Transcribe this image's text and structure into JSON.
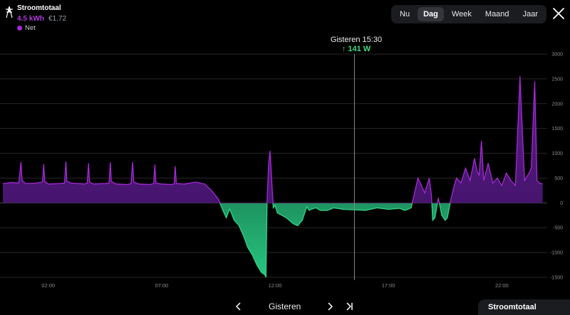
{
  "header": {
    "icon": "power-tower-icon",
    "title": "Stroomtotaal",
    "kwh_value": "4.5",
    "kwh_unit": "kWh",
    "cost": "€1.72",
    "legend_label": "Net"
  },
  "tabs": [
    {
      "label": "Nu",
      "active": false
    },
    {
      "label": "Dag",
      "active": true
    },
    {
      "label": "Week",
      "active": false
    },
    {
      "label": "Maand",
      "active": false
    },
    {
      "label": "Jaar",
      "active": false
    }
  ],
  "close_icon": "close-icon",
  "cursor": {
    "time_label": "Gisteren 15:30",
    "value_label": "↑ 141 W",
    "time_hours": 15.5
  },
  "colors": {
    "import": "#a629d8",
    "export": "#2fd487",
    "cursor_value": "#3ddc84"
  },
  "chart_data": {
    "type": "area",
    "ylabel": "",
    "y_ticks": [
      "3000",
      "2500",
      "2000",
      "1500",
      "1000",
      "500",
      "0",
      "-500",
      "-1000",
      "-1500"
    ],
    "ylim": [
      -1500,
      3000
    ],
    "x_ticks": [
      {
        "label": "02:00",
        "hour": 2
      },
      {
        "label": "07:00",
        "hour": 7
      },
      {
        "label": "12:00",
        "hour": 12
      },
      {
        "label": "17:00",
        "hour": 17
      },
      {
        "label": "22:00",
        "hour": 22
      }
    ],
    "xlim": [
      0,
      24
    ],
    "grid": true,
    "series": [
      {
        "x": [
          0.0,
          0.4,
          0.7,
          0.8,
          0.85,
          1.0,
          1.5,
          1.75,
          1.8,
          1.85,
          2.0,
          2.5,
          2.72,
          2.78,
          2.82,
          3.0,
          3.6,
          3.72,
          3.78,
          3.82,
          4.0,
          4.5,
          4.68,
          4.74,
          4.78,
          5.0,
          5.5,
          5.65,
          5.72,
          5.77,
          6.0,
          6.5,
          6.65,
          6.7,
          6.75,
          7.0,
          7.4,
          7.55,
          7.6,
          7.65,
          8.0,
          8.5,
          8.9,
          9.2,
          9.5,
          9.7,
          9.85,
          10.0,
          10.2,
          10.4,
          10.6,
          10.8,
          11.0,
          11.2,
          11.4,
          11.55,
          11.6,
          11.65,
          11.72,
          11.78,
          11.85,
          11.92,
          12.0,
          12.1,
          12.3,
          12.5,
          12.8,
          13.0,
          13.2,
          13.4,
          13.5,
          13.6,
          13.8,
          14.0,
          14.3,
          14.6,
          15.0,
          15.5,
          16.0,
          16.5,
          17.0,
          17.5,
          17.7,
          17.8,
          18.0,
          18.3,
          18.6,
          18.8,
          18.9,
          18.95,
          19.05,
          19.2,
          19.35,
          19.5,
          19.6,
          19.75,
          19.9,
          20.0,
          20.2,
          20.4,
          20.6,
          20.8,
          20.9,
          21.0,
          21.1,
          21.2,
          21.4,
          21.6,
          21.8,
          22.0,
          22.2,
          22.4,
          22.6,
          22.8,
          23.0,
          23.2,
          23.3,
          23.45,
          23.55,
          23.65,
          23.8
        ],
        "y": [
          390,
          410,
          400,
          820,
          450,
          390,
          400,
          420,
          780,
          430,
          380,
          390,
          400,
          830,
          440,
          400,
          380,
          400,
          800,
          420,
          380,
          390,
          400,
          820,
          430,
          380,
          370,
          390,
          820,
          420,
          380,
          370,
          390,
          770,
          400,
          380,
          370,
          380,
          740,
          390,
          380,
          420,
          380,
          250,
          80,
          -150,
          -300,
          -120,
          -350,
          -450,
          -650,
          -900,
          -1050,
          -1250,
          -1400,
          -1450,
          -1500,
          50,
          800,
          1050,
          500,
          -100,
          -50,
          -200,
          -250,
          -300,
          -420,
          -460,
          -350,
          -80,
          -150,
          -130,
          -100,
          -150,
          -150,
          -100,
          -130,
          -140,
          -150,
          -100,
          -130,
          -110,
          -150,
          -140,
          -100,
          500,
          200,
          500,
          150,
          -350,
          -300,
          100,
          -250,
          -350,
          -300,
          60,
          350,
          500,
          400,
          700,
          450,
          900,
          650,
          550,
          1250,
          450,
          800,
          400,
          500,
          350,
          600,
          450,
          350,
          2550,
          450,
          600,
          700,
          2450,
          450,
          400,
          380
        ]
      }
    ]
  },
  "bottom_nav": {
    "prev_icon": "chevron-left-icon",
    "date_label": "Gisteren",
    "next_icon": "chevron-right-icon",
    "last_icon": "skip-to-end-icon",
    "panel_label": "Stroomtotaal"
  }
}
